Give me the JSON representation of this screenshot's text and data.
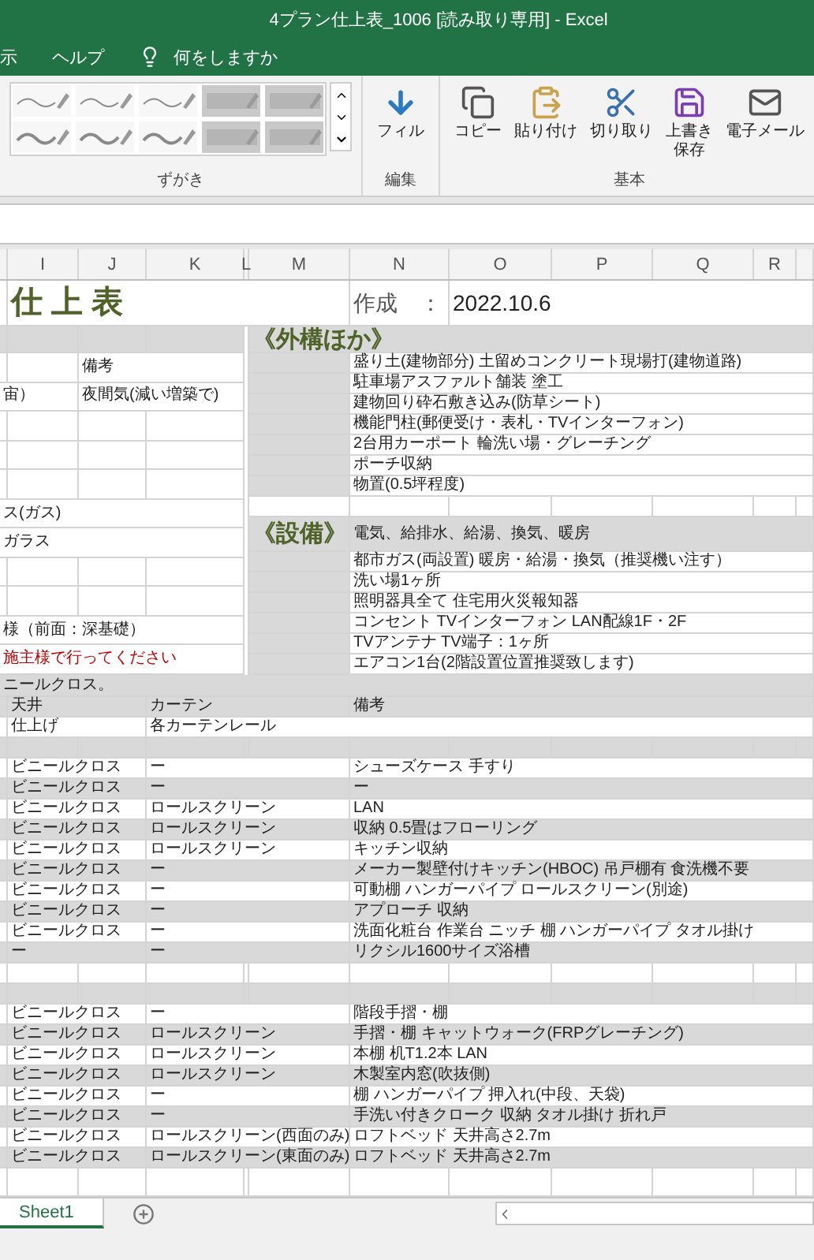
{
  "window": {
    "title": "4プラン仕上表_1006 [読み取り専用] - Excel"
  },
  "menu": [
    {
      "label": "示"
    },
    {
      "label": "ヘルプ"
    }
  ],
  "tell_me": {
    "placeholder": "何をしますか"
  },
  "ribbon": {
    "pens_group": {
      "label": "ずがき",
      "pens": [
        {
          "kind": "pen"
        },
        {
          "kind": "pen"
        },
        {
          "kind": "pen"
        },
        {
          "kind": "highlighter"
        },
        {
          "kind": "highlighter"
        },
        {
          "kind": "pen"
        },
        {
          "kind": "pen"
        },
        {
          "kind": "pen"
        },
        {
          "kind": "highlighter"
        },
        {
          "kind": "highlighter"
        }
      ]
    },
    "groups": [
      {
        "label": "編集",
        "buttons": [
          {
            "kind": "fill",
            "label": "フィル"
          }
        ]
      },
      {
        "label": "基本",
        "buttons": [
          {
            "kind": "copy",
            "label": "コピー"
          },
          {
            "kind": "paste",
            "label": "貼り付け"
          },
          {
            "kind": "cut",
            "label": "切り取り"
          },
          {
            "kind": "save",
            "label": "上書き保存"
          },
          {
            "kind": "mail",
            "label": "電子メール"
          }
        ]
      }
    ]
  },
  "columns": [
    "I",
    "J",
    "K",
    "L",
    "M",
    "N",
    "O",
    "P",
    "Q",
    "R"
  ],
  "sheet": {
    "title": "仕 上 表",
    "created_label": "作成　：",
    "created_date": "2022.10.6",
    "left_rows": [
      {
        "kind": "text",
        "remark": "備考"
      },
      {
        "kind": "text",
        "lead": "宙）",
        "remark": "夜間気(減い増築で)"
      },
      {
        "kind": "text"
      },
      {
        "kind": "text"
      },
      {
        "kind": "text"
      },
      {
        "kind": "text",
        "lead": "ス(ガス)"
      },
      {
        "kind": "text",
        "lead": "ガラス"
      },
      {
        "kind": "text"
      },
      {
        "kind": "text"
      },
      {
        "kind": "text",
        "lead": "様（前面：深基礎）"
      },
      {
        "kind": "warning",
        "lead": "施主様で行ってください"
      }
    ],
    "exterior": {
      "heading": "《外構ほか》",
      "items": [
        "盛り土(建物部分) 土留めコンクリート現場打(建物道路)",
        "駐車場アスファルト舗装 塗工",
        "建物回り砕石敷き込み(防草シート)",
        "機能門柱(郵便受け・表札・TVインターフォン)",
        "2台用カーポート 輪洗い場・グレーチング",
        "ポーチ収納",
        "物置(0.5坪程度)"
      ]
    },
    "equipment": {
      "heading": "《設備》",
      "subheading": "電気、給排水、給湯、換気、暖房",
      "items": [
        "都市ガス(両設置) 暖房・給湯・換気（推奨機い注す）",
        "洗い場1ヶ所",
        "照明器具全て 住宅用火災報知器",
        "コンセント TVインターフォン LAN配線1F・2F",
        "TVアンテナ TV端子：1ヶ所",
        "エアコン1台(2階設置位置推奨致します)"
      ]
    },
    "caption": "ニールクロス。",
    "table": {
      "columns": [
        "天井",
        "カーテン",
        "備考"
      ],
      "rows": [
        {
          "ceiling": "仕上げ",
          "curtain": "各カーテンレール"
        },
        {},
        {
          "ceiling": "ビニールクロス",
          "curtain": "ー",
          "note": "シューズケース 手すり"
        },
        {
          "ceiling": "ビニールクロス",
          "curtain": "ー",
          "note": "ー"
        },
        {
          "ceiling": "ビニールクロス",
          "curtain": "ロールスクリーン",
          "note": "LAN"
        },
        {
          "ceiling": "ビニールクロス",
          "curtain": "ロールスクリーン",
          "note": "収納 0.5畳はフローリング"
        },
        {
          "ceiling": "ビニールクロス",
          "curtain": "ロールスクリーン",
          "note": "キッチン収納"
        },
        {
          "ceiling": "ビニールクロス",
          "curtain": "ー",
          "note": "メーカー製壁付けキッチン(HBOC) 吊戸棚有 食洗機不要"
        },
        {
          "ceiling": "ビニールクロス",
          "curtain": "ー",
          "note": "可動棚 ハンガーパイプ ロールスクリーン(別途)"
        },
        {
          "ceiling": "ビニールクロス",
          "curtain": "ー",
          "note": "アプローチ 収納"
        },
        {
          "ceiling": "ビニールクロス",
          "curtain": "ー",
          "note": "洗面化粧台 作業台 ニッチ 棚 ハンガーパイプ タオル掛け"
        },
        {
          "ceiling": "ー",
          "curtain": "ー",
          "note": "リクシル1600サイズ浴槽"
        },
        {},
        {},
        {
          "ceiling": "ビニールクロス",
          "curtain": "ー",
          "note": "階段手摺・棚"
        },
        {
          "ceiling": "ビニールクロス",
          "curtain": "ロールスクリーン",
          "note": "手摺・棚 キャットウォーク(FRPグレーチング)"
        },
        {
          "ceiling": "ビニールクロス",
          "curtain": "ロールスクリーン",
          "note": "本棚 机T1.2本 LAN"
        },
        {
          "ceiling": "ビニールクロス",
          "curtain": "ロールスクリーン",
          "note": "木製室内窓(吹抜側)"
        },
        {
          "ceiling": "ビニールクロス",
          "curtain": "ー",
          "note": "棚 ハンガーパイプ 押入れ(中段、天袋)"
        },
        {
          "ceiling": "ビニールクロス",
          "curtain": "ー",
          "note": "手洗い付きクローク 収納 タオル掛け 折れ戸"
        },
        {
          "ceiling": "ビニールクロス",
          "curtain": "ロールスクリーン(西面のみ)",
          "note": "ロフトベッド 天井高さ2.7m"
        },
        {
          "ceiling": "ビニールクロス",
          "curtain": "ロールスクリーン(東面のみ)",
          "note": "ロフトベッド 天井高さ2.7m"
        }
      ]
    }
  },
  "sheet_tabs": [
    {
      "label": "Sheet1",
      "selected": true
    }
  ]
}
